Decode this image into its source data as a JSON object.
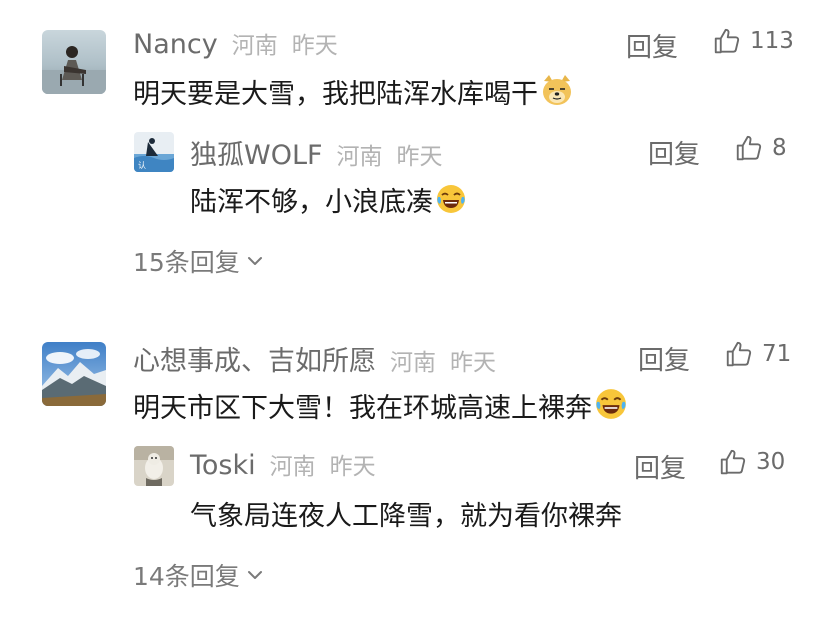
{
  "comments": [
    {
      "user": "Nancy",
      "location": "河南",
      "time": "昨天",
      "reply_label": "回复",
      "likes": "113",
      "text": "明天要是大雪，我把陆浑水库喝干",
      "emoji": "doge-emoji",
      "replies": [
        {
          "user": "独孤WOLF",
          "location": "河南",
          "time": "昨天",
          "reply_label": "回复",
          "likes": "8",
          "text": "陆浑不够，小浪底凑",
          "emoji": "laughing-tears-emoji"
        }
      ],
      "more_replies": "15条回复"
    },
    {
      "user": "心想事成、吉如所愿",
      "location": "河南",
      "time": "昨天",
      "reply_label": "回复",
      "likes": "71",
      "text": "明天市区下大雪！我在环城高速上裸奔",
      "emoji": "laughing-tears-emoji",
      "replies": [
        {
          "user": "Toski",
          "location": "河南",
          "time": "昨天",
          "reply_label": "回复",
          "likes": "30",
          "text": "气象局连夜人工降雪，就为看你裸奔"
        }
      ],
      "more_replies": "14条回复"
    }
  ],
  "colors": {
    "username": "#6b6b6b",
    "meta": "#b3b3b3",
    "text": "#1a1a1a",
    "background": "#ffffff"
  }
}
